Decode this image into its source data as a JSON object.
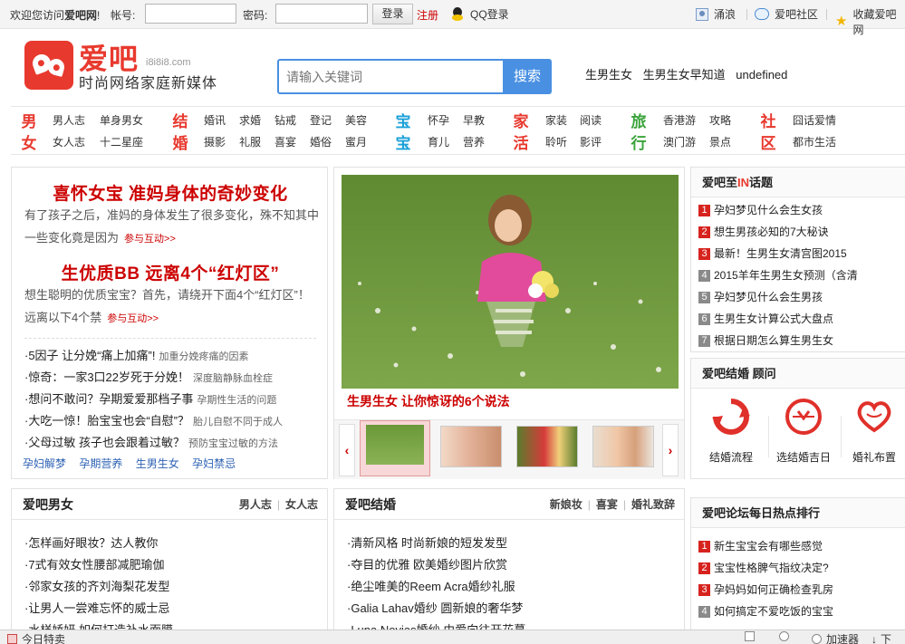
{
  "topbar": {
    "welcome_prefix": "欢迎您访问",
    "site_name": "爱吧网",
    "welcome_suffix": "!",
    "account_label": "帐号:",
    "password_label": "密码:",
    "account_value": "",
    "password_value": "",
    "login_label": "登录",
    "register_label": "注册",
    "qq_login_label": "QQ登录",
    "user_label": "涌浪",
    "community_label": "爱吧社区",
    "favorite_label": "收藏爱吧网"
  },
  "header": {
    "brand": "爱吧",
    "domain": "i8i8i8.com",
    "slogan": "时尚网络家庭新媒体",
    "search_placeholder": "请输入关键词",
    "search_button": "搜索",
    "hot_links": [
      "生男生女",
      "生男生女早知道",
      "undefined"
    ]
  },
  "nav": {
    "groups": [
      {
        "cat": [
          "男",
          "女"
        ],
        "color": "#e8392e",
        "links": [
          "男人志",
          "单身男女",
          "女人志",
          "十二星座"
        ]
      },
      {
        "cat": [
          "结",
          "婚"
        ],
        "color": "#e8392e",
        "links": [
          "婚讯",
          "求婚",
          "钻戒",
          "登记",
          "美容",
          "摄影",
          "礼服",
          "喜宴",
          "婚俗",
          "蜜月"
        ]
      },
      {
        "cat": [
          "宝",
          "宝"
        ],
        "color": "#1aa0d8",
        "links": [
          "怀孕",
          "早教",
          "育儿",
          "营养"
        ]
      },
      {
        "cat": [
          "家",
          "活"
        ],
        "color": "#e8392e",
        "links": [
          "家装",
          "阅读",
          "聆听",
          "影评"
        ]
      },
      {
        "cat": [
          "旅",
          "行"
        ],
        "color": "#3aa33a",
        "links": [
          "香港游",
          "攻略",
          "澳门游",
          "景点"
        ]
      },
      {
        "cat": [
          "社",
          "区"
        ],
        "color": "#e8392e",
        "links": [
          "囧话爱情",
          "都市生活"
        ]
      }
    ]
  },
  "featured": {
    "items": [
      {
        "title": "喜怀女宝 准妈身体的奇妙变化",
        "desc": "有了孩子之后，准妈的身体发生了很多变化，殊不知其中一些变化竟是因为",
        "more": "参与互动>>"
      },
      {
        "title": "生优质BB 远离4个“红灯区”",
        "desc": "想生聪明的优质宝宝？首先，请绕开下面4个“红灯区”！远离以下4个禁",
        "more": "参与互动>>"
      }
    ],
    "list": [
      {
        "main": "·5因子 让分娩“痛上加痛”!",
        "sub": "加重分娩疼痛的因素"
      },
      {
        "main": "·惊奇：一家3口22岁死于分娩！",
        "sub": "深度脑静脉血栓症"
      },
      {
        "main": "·想问不敢问？孕期爱爱那档子事",
        "sub": "孕期性生活的问题"
      },
      {
        "main": "·大吃一惊！胎宝宝也会“自慰”？",
        "sub": "胎儿自慰不同于成人"
      },
      {
        "main": "·父母过敏 孩子也会跟着过敏？",
        "sub": "预防宝宝过敏的方法"
      }
    ],
    "tags": [
      "孕妇解梦",
      "孕期营养",
      "生男生女",
      "孕妇禁忌"
    ]
  },
  "slider": {
    "caption": "生男生女 让你惊讶的6个说法",
    "prev": "‹",
    "next": "›"
  },
  "hot_topics": {
    "title_prefix": "爱吧至",
    "title_em": "IN",
    "title_suffix": "话题",
    "items": [
      {
        "rank": "1",
        "text": "孕妇梦见什么会生女孩"
      },
      {
        "rank": "2",
        "text": "想生男孩必知的7大秘诀"
      },
      {
        "rank": "3",
        "text": "最新！生男生女清宫图2015"
      },
      {
        "rank": "4",
        "text": "2015羊年生男生女预测（含清"
      },
      {
        "rank": "5",
        "text": "孕妇梦见什么会生男孩"
      },
      {
        "rank": "6",
        "text": "生男生女计算公式大盘点"
      },
      {
        "rank": "7",
        "text": "根据日期怎么算生男生女"
      }
    ]
  },
  "wedding": {
    "title": "爱吧结婚 顾问",
    "items": [
      "结婚流程",
      "选结婚吉日",
      "婚礼布置"
    ]
  },
  "forum": {
    "title": "爱吧论坛每日热点排行",
    "items": [
      {
        "rank": "1",
        "text": "新生宝宝会有哪些感觉"
      },
      {
        "rank": "2",
        "text": "宝宝性格脾气指纹决定?"
      },
      {
        "rank": "3",
        "text": "孕妈妈如何正确检查乳房"
      },
      {
        "rank": "4",
        "text": "如何搞定不爱吃饭的宝宝"
      }
    ]
  },
  "men": {
    "title": "爱吧男女",
    "links": [
      "男人志",
      "女人志"
    ],
    "items": [
      "·怎样画好眼妆？达人教你",
      "·7式有效女性腰部减肥瑜伽",
      "·邻家女孩的齐刘海梨花发型",
      "·让男人一尝难忘怀的威士忌",
      "·水样娇妍 如何打造补水面膜"
    ]
  },
  "wedding_sect": {
    "title": "爱吧结婚",
    "links": [
      "新娘妆",
      "喜宴",
      "婚礼致辞"
    ],
    "items": [
      "·清新风格 时尚新娘的短发发型",
      "·夺目的优雅 欧美婚纱图片欣赏",
      "·绝尘唯美的Reem Acra婚纱礼服",
      "·Galia Lahav婚纱 圆新娘的奢华梦",
      "·Luna Novias婚纱 由爱向往开花蔓"
    ]
  },
  "statusbar": {
    "left": "今日特卖",
    "accelerator": "加速器",
    "download": "下"
  }
}
